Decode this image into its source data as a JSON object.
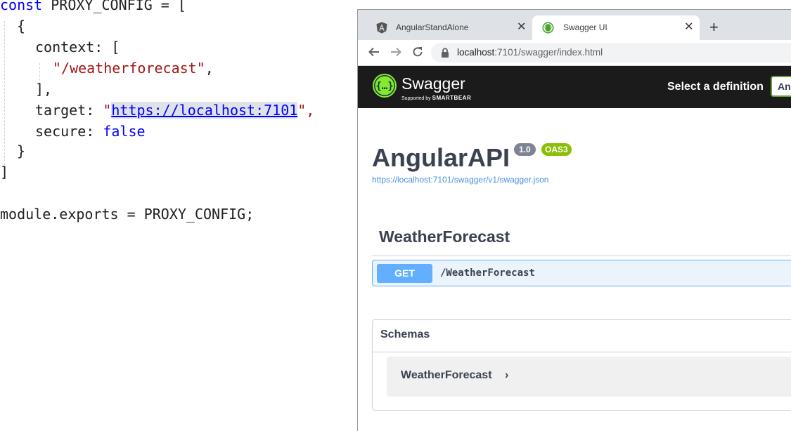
{
  "editor": {
    "line1": {
      "kw": "const",
      "rest": " PROXY_CONFIG = ["
    },
    "line2": "{",
    "line3": "context: [",
    "line4": "\"/weatherforecast\"",
    "line4_tail": ",",
    "line5": "],",
    "line6": {
      "key": "target: ",
      "q1": "\"",
      "url": "https://localhost:7101",
      "q2": "\",",
      "full": "target: \"https://localhost:7101\","
    },
    "line7": {
      "key": "secure: ",
      "val": "false"
    },
    "line8": "}",
    "line9": "]",
    "line11": "module.exports = PROXY_CONFIG;"
  },
  "browser": {
    "tabs": [
      {
        "title": "AngularStandAlone",
        "icon": "angular-icon",
        "close": "✕"
      },
      {
        "title": "Swagger UI",
        "icon": "swagger-favicon",
        "close": "✕"
      }
    ],
    "new_tab": "+",
    "url_host": "localhost",
    "url_rest": ":7101/swagger/index.html"
  },
  "swagger": {
    "brand": "Swagger",
    "supported_by": "Supported by",
    "smartbear": "SMARTBEAR",
    "select_definition_label": "Select a definition",
    "select_definition_value": "An",
    "api_title": "AngularAPI",
    "version_badge": "1.0",
    "oas_badge": "OAS3",
    "spec_link": "https://localhost:7101/swagger/v1/swagger.json",
    "tag": "WeatherForecast",
    "operation": {
      "method": "GET",
      "path": "/WeatherForecast"
    },
    "schemas_title": "Schemas",
    "schema_model": "WeatherForecast",
    "schema_chevron": "›"
  },
  "colors": {
    "get_blue": "#61affe",
    "swagger_green": "#89bf04",
    "topbar": "#1b1b1b",
    "code_keyword": "#0000ff",
    "code_string": "#a31515"
  }
}
